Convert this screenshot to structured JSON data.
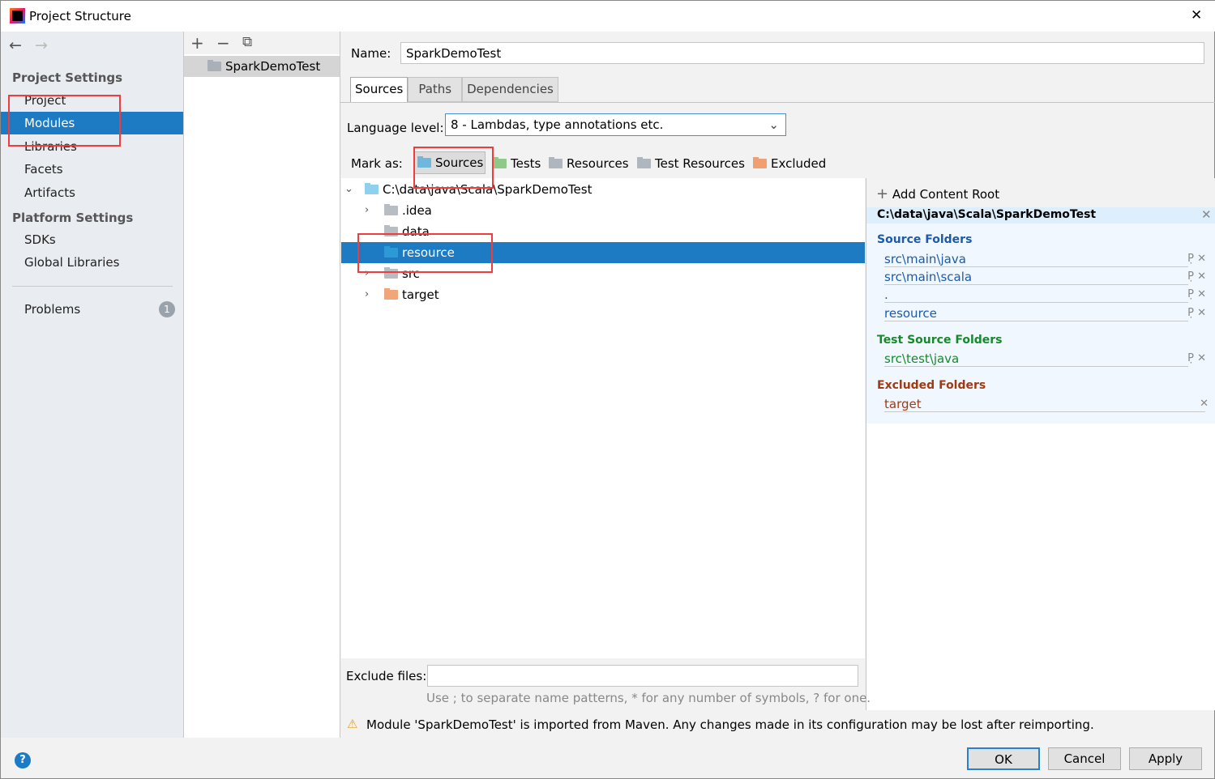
{
  "window": {
    "title": "Project Structure",
    "close": "✕"
  },
  "sidebar": {
    "back": "←",
    "forward": "→",
    "project_settings": "Project Settings",
    "items": [
      {
        "label": "Project"
      },
      {
        "label": "Modules"
      },
      {
        "label": "Libraries"
      },
      {
        "label": "Facets"
      },
      {
        "label": "Artifacts"
      }
    ],
    "platform_settings": "Platform Settings",
    "platform_items": [
      {
        "label": "SDKs"
      },
      {
        "label": "Global Libraries"
      }
    ],
    "problems": "Problems",
    "problems_count": "1"
  },
  "modules": {
    "add": "+",
    "remove": "−",
    "copy": "⧉",
    "items": [
      {
        "label": "SparkDemoTest"
      }
    ]
  },
  "main": {
    "name_label": "Name:",
    "name_value": "SparkDemoTest",
    "tabs": [
      {
        "label": "Sources"
      },
      {
        "label": "Paths"
      },
      {
        "label": "Dependencies"
      }
    ],
    "language_label": "Language level:",
    "language_value": "8 - Lambdas, type annotations etc.",
    "mark_as": "Mark as:",
    "mark_buttons": [
      {
        "label": "Sources",
        "color": "#6fb7dd"
      },
      {
        "label": "Tests",
        "color": "#8fc98a"
      },
      {
        "label": "Resources",
        "color": "#b0b6bd"
      },
      {
        "label": "Test Resources",
        "color": "#b0b6bd"
      },
      {
        "label": "Excluded",
        "color": "#f0a070"
      }
    ],
    "tree": [
      {
        "label": "C:\\data\\java\\Scala\\SparkDemoTest",
        "expanded": true,
        "color": "#8fd0ee"
      },
      {
        "label": ".idea",
        "color": "#b8bdc3"
      },
      {
        "label": "data",
        "color": "#b8bdc3"
      },
      {
        "label": "resource",
        "color": "#2d9ad8",
        "selected": true
      },
      {
        "label": "src",
        "color": "#b8bdc3"
      },
      {
        "label": "target",
        "color": "#f3a57a"
      }
    ],
    "exclude_label": "Exclude files:",
    "exclude_value": "",
    "exclude_hint": "Use ; to separate name patterns, * for any number of symbols, ? for one.",
    "warning": "Module 'SparkDemoTest' is imported from Maven. Any changes made in its configuration may be lost after reimporting."
  },
  "content_root": {
    "add": "Add Content Root",
    "path": "C:\\data\\java\\Scala\\SparkDemoTest",
    "source_title": "Source Folders",
    "source": [
      "src\\main\\java",
      "src\\main\\scala",
      ".",
      "resource"
    ],
    "test_title": "Test Source Folders",
    "test": [
      "src\\test\\java"
    ],
    "excluded_title": "Excluded Folders",
    "excluded": [
      "target"
    ],
    "colors": {
      "source": "#1c5aaa",
      "test": "#168a2a",
      "excluded": "#a03a10"
    }
  },
  "footer": {
    "help": "?",
    "ok": "OK",
    "cancel": "Cancel",
    "apply": "Apply"
  }
}
